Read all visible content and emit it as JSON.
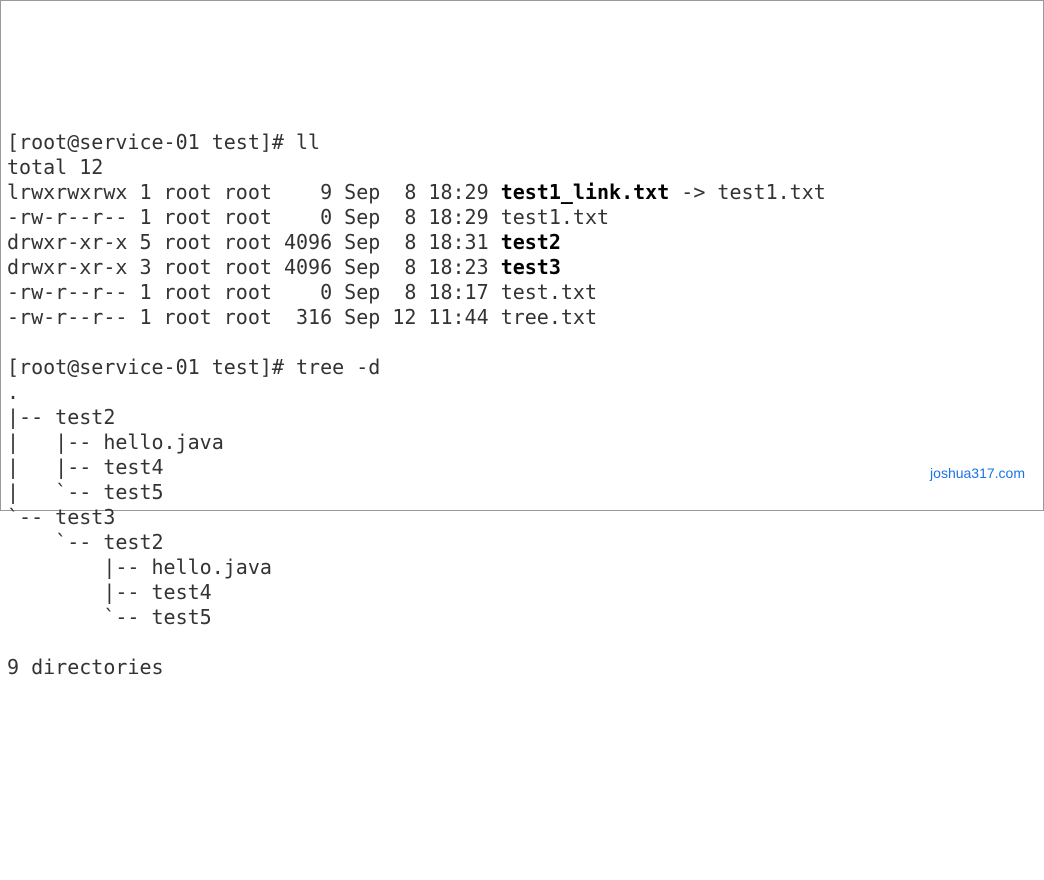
{
  "prompt1": {
    "prefix": "[root@service-01 test]# ",
    "cmd": "ll"
  },
  "total": "total 12",
  "ll": [
    {
      "perm": "lrwxrwxrwx",
      "links": "1",
      "owner": "root",
      "group": "root",
      "size": "   9",
      "month": "Sep",
      "day": " 8",
      "time": "18:29",
      "name": "test1_link.txt",
      "arrow": " -> test1.txt",
      "bold": true
    },
    {
      "perm": "-rw-r--r--",
      "links": "1",
      "owner": "root",
      "group": "root",
      "size": "   0",
      "month": "Sep",
      "day": " 8",
      "time": "18:29",
      "name": "test1.txt",
      "arrow": "",
      "bold": false
    },
    {
      "perm": "drwxr-xr-x",
      "links": "5",
      "owner": "root",
      "group": "root",
      "size": "4096",
      "month": "Sep",
      "day": " 8",
      "time": "18:31",
      "name": "test2",
      "arrow": "",
      "bold": true
    },
    {
      "perm": "drwxr-xr-x",
      "links": "3",
      "owner": "root",
      "group": "root",
      "size": "4096",
      "month": "Sep",
      "day": " 8",
      "time": "18:23",
      "name": "test3",
      "arrow": "",
      "bold": true
    },
    {
      "perm": "-rw-r--r--",
      "links": "1",
      "owner": "root",
      "group": "root",
      "size": "   0",
      "month": "Sep",
      "day": " 8",
      "time": "18:17",
      "name": "test.txt",
      "arrow": "",
      "bold": false
    },
    {
      "perm": "-rw-r--r--",
      "links": "1",
      "owner": "root",
      "group": "root",
      "size": " 316",
      "month": "Sep",
      "day": "12",
      "time": "11:44",
      "name": "tree.txt",
      "arrow": "",
      "bold": false
    }
  ],
  "prompt2": {
    "prefix": "[root@service-01 test]# ",
    "cmd": "tree -d"
  },
  "tree": [
    ".",
    "|-- test2",
    "|   |-- hello.java",
    "|   |-- test4",
    "|   `-- test5",
    "`-- test3",
    "    `-- test2",
    "        |-- hello.java",
    "        |-- test4",
    "        `-- test5",
    "",
    "9 directories"
  ],
  "watermark": "joshua317.com"
}
